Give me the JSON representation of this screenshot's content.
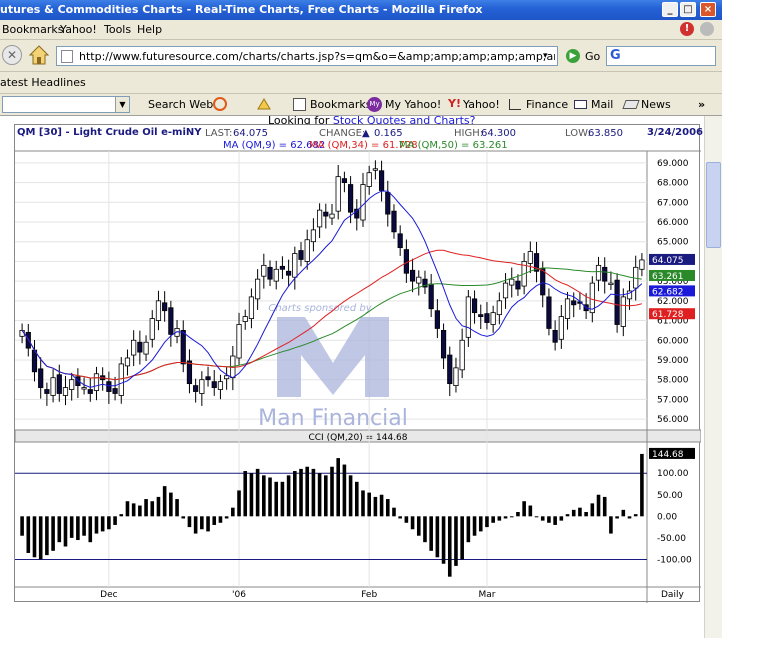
{
  "window": {
    "title": "utures & Commodities Charts - Real-Time Charts, Free Charts - Mozilla Firefox"
  },
  "menu": [
    "Bookmarks",
    "Yahoo!",
    "Tools",
    "Help"
  ],
  "nav": {
    "url": "http://www.futuresource.com/charts/charts.jsp?s=qm&o=&amp;amp;amp;amp;amp;amp;amp;amp;amp;a=D&",
    "go_label": "Go",
    "search_engine_letter": "G"
  },
  "bookmarks_bar": {
    "item": "atest Headlines"
  },
  "yahoo_bar": {
    "search_web": "Search Web",
    "bookmarks": "Bookmarks",
    "my_yahoo": "My Yahoo!",
    "yahoo": "Yahoo!",
    "finance": "Finance",
    "mail": "Mail",
    "news": "News",
    "more": "»"
  },
  "page": {
    "link_prefix": "Looking for ",
    "link_text": "Stock Quotes and Charts?"
  },
  "chart_header": {
    "symbol": "QM [30] - Light Crude Oil e-miNY",
    "last_label": "LAST:",
    "last": "64.075",
    "change_label": "CHANGE:",
    "change": "0.165",
    "high_label": "HIGH:",
    "high": "64.300",
    "low_label": "LOW:",
    "low": "63.850",
    "date": "3/24/2006",
    "ma9": "MA (QM,9) = 62.682",
    "ma34": "MA (QM,34) = 61.728",
    "ma50": "MA (QM,50) = 63.261",
    "cci": "CCI (QM,20) = 144.68",
    "watermark_top": "Charts sponsored by",
    "watermark_bottom": "Man Financial",
    "period": "Daily"
  },
  "colors": {
    "ma9": "#1a1ad8",
    "ma34": "#e02020",
    "ma50": "#2a8a2a",
    "last_badge": "#1a1a80",
    "watermark": "#aab4dc"
  },
  "chart_data": {
    "type": "candlestick",
    "price_axis": {
      "ticks": [
        "69.000",
        "68.000",
        "67.000",
        "66.000",
        "65.000",
        "64.000",
        "63.000",
        "62.000",
        "61.000",
        "60.000",
        "59.000",
        "58.000",
        "57.000",
        "56.000"
      ],
      "ylim": [
        55.6,
        69.5
      ]
    },
    "value_badges": [
      {
        "label": "64.075",
        "value": 64.075,
        "color": "#1a1a80"
      },
      {
        "label": "63.261",
        "value": 63.261,
        "color": "#2a8a2a"
      },
      {
        "label": "62.682",
        "value": 62.682,
        "color": "#1a1ad8"
      },
      {
        "label": "61.728",
        "value": 61.728,
        "color": "#e02020"
      }
    ],
    "x_labels": [
      "Dec",
      "'06",
      "Feb",
      "Mar"
    ],
    "x_label_index": [
      14,
      35,
      56,
      75
    ],
    "closes": [
      60.5,
      59.6,
      58.4,
      57.6,
      57.3,
      58.1,
      57.3,
      57.6,
      58.0,
      57.7,
      57.6,
      57.3,
      58.3,
      58.0,
      57.4,
      57.3,
      58.8,
      59.1,
      60.0,
      59.4,
      59.9,
      61.1,
      62.0,
      61.5,
      60.3,
      60.6,
      58.8,
      57.8,
      57.4,
      58.0,
      58.0,
      57.6,
      57.9,
      58.2,
      59.2,
      60.8,
      61.2,
      62.2,
      63.1,
      63.8,
      63.1,
      63.6,
      63.6,
      63.3,
      64.4,
      64.1,
      65.1,
      65.6,
      66.6,
      66.3,
      66.4,
      68.3,
      68.0,
      66.5,
      66.2,
      67.9,
      68.5,
      68.7,
      67.6,
      66.4,
      65.5,
      64.7,
      63.4,
      63.0,
      63.2,
      62.7,
      61.6,
      60.6,
      59.1,
      57.8,
      58.6,
      60.0,
      62.2,
      61.4,
      61.2,
      60.9,
      61.4,
      62.0,
      62.9,
      63.1,
      62.6,
      64.0,
      64.5,
      63.5,
      62.3,
      60.6,
      59.9,
      61.2,
      62.1,
      61.8,
      61.9,
      61.5,
      62.9,
      63.8,
      63.0,
      62.9,
      60.8,
      62.2,
      62.5,
      63.7,
      64.075
    ],
    "cci": {
      "name": "CCI (QM,20)",
      "ticks": [
        "100.00",
        "50.00",
        "0.00",
        "-50.00",
        "-100.00"
      ],
      "ylim": [
        -150,
        170
      ],
      "reference_lines": [
        100,
        -100
      ],
      "values": [
        -45,
        -85,
        -95,
        -100,
        -90,
        -80,
        -60,
        -70,
        -50,
        -55,
        -45,
        -60,
        -40,
        -35,
        -30,
        -20,
        5,
        35,
        30,
        25,
        40,
        35,
        45,
        70,
        55,
        40,
        -5,
        -25,
        -40,
        -30,
        -35,
        -20,
        -15,
        -5,
        20,
        60,
        105,
        100,
        110,
        95,
        90,
        80,
        80,
        95,
        105,
        110,
        115,
        110,
        100,
        95,
        115,
        135,
        120,
        95,
        80,
        60,
        55,
        45,
        50,
        40,
        20,
        -5,
        -15,
        -30,
        -45,
        -60,
        -80,
        -95,
        -110,
        -140,
        -115,
        -100,
        -60,
        -45,
        -35,
        -25,
        -15,
        -10,
        -5,
        0,
        10,
        35,
        25,
        0,
        -10,
        -15,
        -20,
        -10,
        5,
        15,
        20,
        10,
        30,
        50,
        45,
        -40,
        -5,
        15,
        -5,
        5,
        144.68
      ]
    }
  }
}
